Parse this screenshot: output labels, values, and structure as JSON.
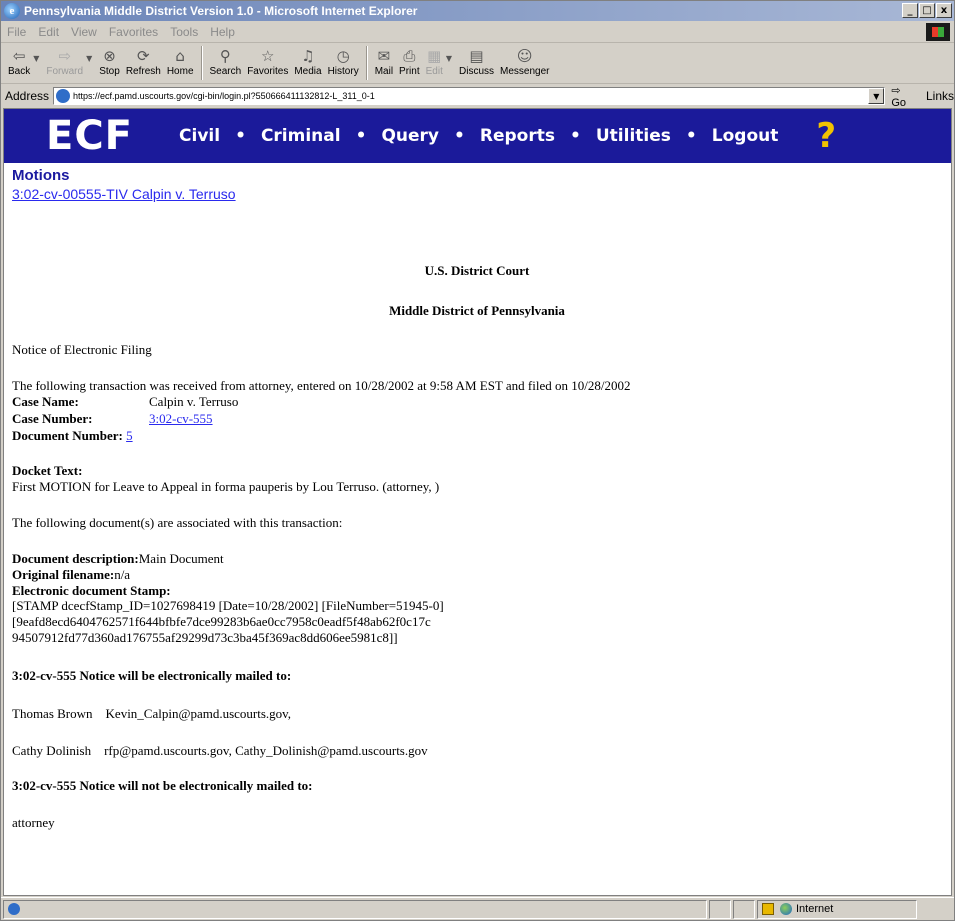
{
  "window": {
    "title": "Pennsylvania Middle District Version 1.0 - Microsoft Internet Explorer",
    "minimize": "_",
    "maximize": "□",
    "close": "x"
  },
  "menu": [
    "File",
    "Edit",
    "View",
    "Favorites",
    "Tools",
    "Help"
  ],
  "toolbar": {
    "back": "Back",
    "forward": "Forward",
    "stop": "Stop",
    "refresh": "Refresh",
    "home": "Home",
    "search": "Search",
    "favorites": "Favorites",
    "media": "Media",
    "history": "History",
    "mail": "Mail",
    "print": "Print",
    "edit": "Edit",
    "discuss": "Discuss",
    "messenger": "Messenger"
  },
  "address": {
    "label": "Address",
    "url": "https://ecf.pamd.uscourts.gov/cgi-bin/login.pl?550666411132812-L_311_0-1",
    "go": "Go",
    "links": "Links"
  },
  "ecf_nav": {
    "logo": "ECF",
    "items": [
      "Civil",
      "Criminal",
      "Query",
      "Reports",
      "Utilities",
      "Logout"
    ],
    "separator": "•",
    "help_icon": "?"
  },
  "page": {
    "section_title": "Motions",
    "case_link": "3:02-cv-00555-TIV Calpin v. Terruso",
    "court": "U.S. District Court",
    "district": "Middle District of Pennsylvania",
    "notice_heading": "Notice of Electronic Filing",
    "transaction_text": "The following transaction was received from attorney, entered on 10/28/2002 at 9:58 AM EST and filed on 10/28/2002",
    "case_name_label": "Case Name:",
    "case_name_value": "Calpin v. Terruso",
    "case_number_label": "Case Number:",
    "case_number_value": "3:02-cv-555",
    "document_number_label": "Document Number:",
    "document_number_value": "5",
    "docket_text_label": "Docket Text:",
    "docket_text": "First MOTION for Leave to Appeal in forma pauperis by Lou Terruso. (attorney, )",
    "associated_docs": "The following document(s) are associated with this transaction:",
    "doc_description_label": "Document description:",
    "doc_description_value": "Main Document",
    "original_filename_label": "Original filename:",
    "original_filename_value": "n/a",
    "stamp_label": "Electronic document Stamp:",
    "stamp_line1": "[STAMP dcecfStamp_ID=1027698419 [Date=10/28/2002] [FileNumber=51945-0]",
    "stamp_line2": "[9eafd8ecd6404762571f644bfbfe7dce99283b6ae0cc7958c0eadf5f48ab62f0c17c",
    "stamp_line3": "94507912fd77d360ad176755af29299d73c3ba45f369ac8dd606ee5981c8]]",
    "mailed_heading": "3:02-cv-555 Notice will be electronically mailed to:",
    "recipients": [
      {
        "name": "Thomas Brown",
        "emails": "Kevin_Calpin@pamd.uscourts.gov,"
      },
      {
        "name": "Cathy Dolinish",
        "emails": "rfp@pamd.uscourts.gov, Cathy_Dolinish@pamd.uscourts.gov"
      }
    ],
    "not_mailed_heading": "3:02-cv-555 Notice will not be electronically mailed to:",
    "not_mailed_recipient": "attorney"
  },
  "status": {
    "zone": "Internet"
  }
}
